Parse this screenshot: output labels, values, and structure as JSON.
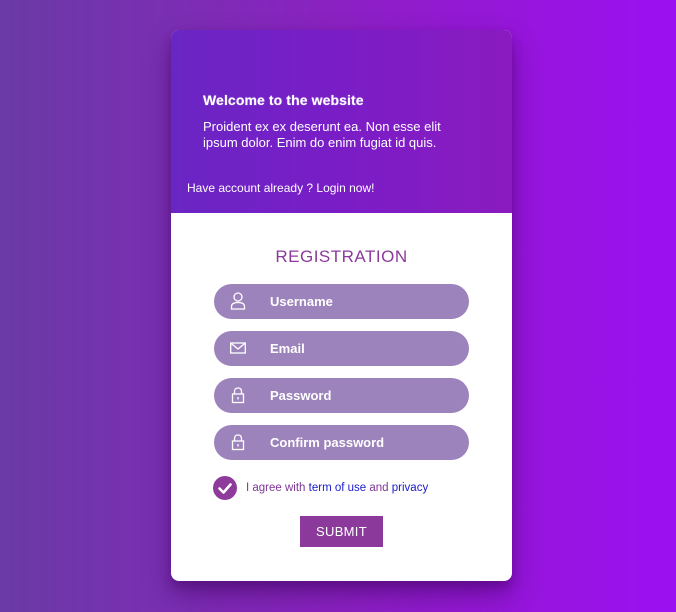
{
  "hero": {
    "title": "Welcome to the website",
    "text": "Proident ex ex deserunt ea. Non esse elit ipsum dolor. Enim do enim fugiat id quis.",
    "login_prompt": "Have account already ? Login now!"
  },
  "form": {
    "title": "REGISTRATION",
    "fields": [
      {
        "label": "Username",
        "icon": "user-icon"
      },
      {
        "label": "Email",
        "icon": "envelope-icon"
      },
      {
        "label": "Password",
        "icon": "lock-icon"
      },
      {
        "label": "Confirm password",
        "icon": "lock-icon"
      }
    ],
    "agree": {
      "checked": true,
      "prefix": "I agree with ",
      "terms_link": "term of use",
      "middle": " and ",
      "privacy_link": "privacy"
    },
    "submit_label": "SUBMIT"
  },
  "colors": {
    "accent": "#8b3a9c",
    "field_bg": "#9d83bb",
    "link": "#1a1acc",
    "hero_gradient_start": "#6a26c4",
    "hero_gradient_end": "#8a1bbf"
  }
}
